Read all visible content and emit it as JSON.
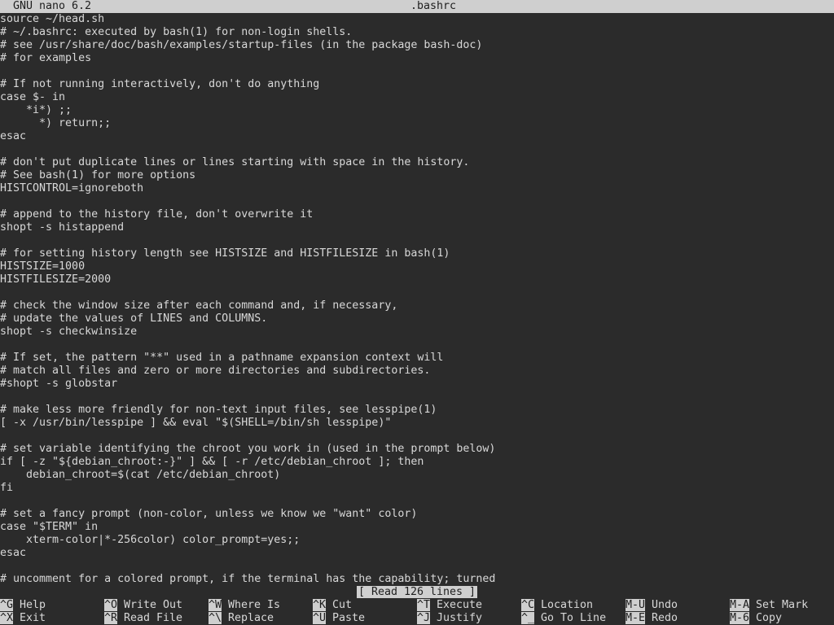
{
  "title": {
    "app": "GNU nano 6.2",
    "file": ".bashrc"
  },
  "lines": [
    "source ~/head.sh",
    "# ~/.bashrc: executed by bash(1) for non-login shells.",
    "# see /usr/share/doc/bash/examples/startup-files (in the package bash-doc)",
    "# for examples",
    "",
    "# If not running interactively, don't do anything",
    "case $- in",
    "    *i*) ;;",
    "      *) return;;",
    "esac",
    "",
    "# don't put duplicate lines or lines starting with space in the history.",
    "# See bash(1) for more options",
    "HISTCONTROL=ignoreboth",
    "",
    "# append to the history file, don't overwrite it",
    "shopt -s histappend",
    "",
    "# for setting history length see HISTSIZE and HISTFILESIZE in bash(1)",
    "HISTSIZE=1000",
    "HISTFILESIZE=2000",
    "",
    "# check the window size after each command and, if necessary,",
    "# update the values of LINES and COLUMNS.",
    "shopt -s checkwinsize",
    "",
    "# If set, the pattern \"**\" used in a pathname expansion context will",
    "# match all files and zero or more directories and subdirectories.",
    "#shopt -s globstar",
    "",
    "# make less more friendly for non-text input files, see lesspipe(1)",
    "[ -x /usr/bin/lesspipe ] && eval \"$(SHELL=/bin/sh lesspipe)\"",
    "",
    "# set variable identifying the chroot you work in (used in the prompt below)",
    "if [ -z \"${debian_chroot:-}\" ] && [ -r /etc/debian_chroot ]; then",
    "    debian_chroot=$(cat /etc/debian_chroot)",
    "fi",
    "",
    "# set a fancy prompt (non-color, unless we know we \"want\" color)",
    "case \"$TERM\" in",
    "    xterm-color|*-256color) color_prompt=yes;;",
    "esac",
    "",
    "# uncomment for a colored prompt, if the terminal has the capability; turned"
  ],
  "status": "[ Read 126 lines ]",
  "shortcuts": [
    {
      "key": "^G",
      "label": "Help"
    },
    {
      "key": "^X",
      "label": "Exit"
    },
    {
      "key": "^O",
      "label": "Write Out"
    },
    {
      "key": "^R",
      "label": "Read File"
    },
    {
      "key": "^W",
      "label": "Where Is"
    },
    {
      "key": "^\\",
      "label": "Replace"
    },
    {
      "key": "^K",
      "label": "Cut"
    },
    {
      "key": "^U",
      "label": "Paste"
    },
    {
      "key": "^T",
      "label": "Execute"
    },
    {
      "key": "^J",
      "label": "Justify"
    },
    {
      "key": "^C",
      "label": "Location"
    },
    {
      "key": "^_",
      "label": "Go To Line"
    },
    {
      "key": "M-U",
      "label": "Undo"
    },
    {
      "key": "M-E",
      "label": "Redo"
    },
    {
      "key": "M-A",
      "label": "Set Mark"
    },
    {
      "key": "M-6",
      "label": "Copy"
    }
  ]
}
